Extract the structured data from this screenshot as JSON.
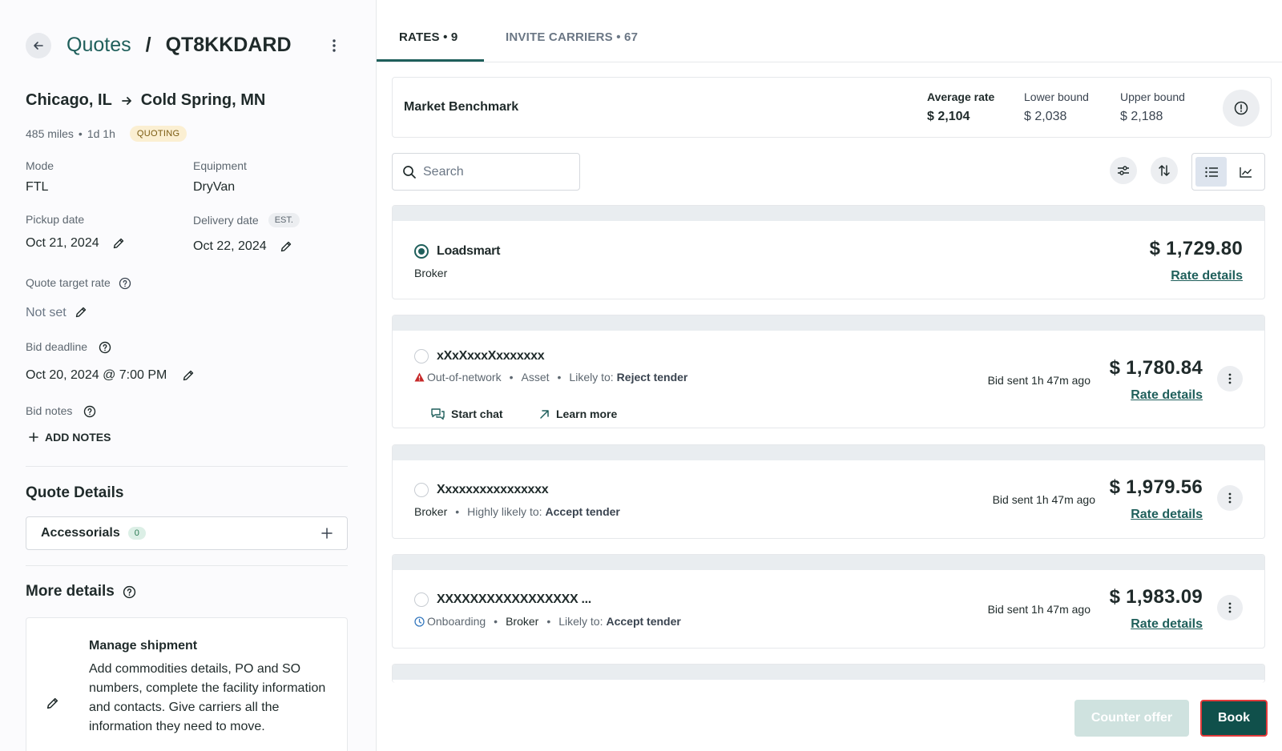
{
  "header": {
    "breadcrumb_parent": "Quotes",
    "breadcrumb_separator": "/",
    "quote_id": "QT8KKDARD"
  },
  "shipment": {
    "origin": "Chicago, IL",
    "destination": "Cold Spring, MN",
    "distance": "485 miles",
    "duration": "1d 1h",
    "status_badge": "QUOTING",
    "mode_label": "Mode",
    "mode_value": "FTL",
    "equipment_label": "Equipment",
    "equipment_value": "DryVan",
    "pickup_label": "Pickup date",
    "pickup_value": "Oct 21, 2024",
    "delivery_label": "Delivery date",
    "delivery_badge": "EST.",
    "delivery_value": "Oct 22, 2024",
    "target_rate_label": "Quote target rate",
    "target_rate_value": "Not set",
    "bid_deadline_label": "Bid deadline",
    "bid_deadline_value": "Oct 20, 2024 @ 7:00 PM",
    "bid_notes_label": "Bid notes",
    "add_notes_label": "ADD NOTES"
  },
  "quote_details": {
    "title": "Quote Details",
    "accessorials_label": "Accessorials",
    "accessorials_count": "0"
  },
  "more_details": {
    "title": "More details",
    "manage_title": "Manage shipment",
    "manage_text": "Add commodities details, PO and SO numbers, complete the facility information and contacts. Give carriers all the information they need to move."
  },
  "tabs": [
    {
      "label": "RATES • 9",
      "active": true
    },
    {
      "label": "INVITE CARRIERS • 67",
      "active": false
    }
  ],
  "benchmark": {
    "title": "Market Benchmark",
    "average_label": "Average rate",
    "average_value": "$ 2,104",
    "lower_label": "Lower bound",
    "lower_value": "$ 2,038",
    "upper_label": "Upper bound",
    "upper_value": "$ 2,188"
  },
  "search": {
    "placeholder": "Search"
  },
  "rates": [
    {
      "name": "Loadsmart",
      "type": "Broker",
      "price": "$ 1,729.80",
      "link": "Rate details",
      "selected": true
    },
    {
      "name": "xXxXxxxXxxxxxxx",
      "network": "Out-of-network",
      "type": "Asset",
      "likely_label": "Likely to:",
      "likely_value": "Reject tender",
      "bid_sent": "Bid sent 1h 47m ago",
      "price": "$ 1,780.84",
      "link": "Rate details",
      "start_chat": "Start chat",
      "learn_more": "Learn more"
    },
    {
      "name": "Xxxxxxxxxxxxxxxx",
      "type": "Broker",
      "likely_label": "Highly likely to:",
      "likely_value": "Accept tender",
      "bid_sent": "Bid sent 1h 47m ago",
      "price": "$ 1,979.56",
      "link": "Rate details"
    },
    {
      "name": "XXXXXXXXXXXXXXXXX ...",
      "onboarding": "Onboarding",
      "type": "Broker",
      "likely_label": "Likely to:",
      "likely_value": "Accept tender",
      "bid_sent": "Bid sent 1h 47m ago",
      "price": "$ 1,983.09",
      "link": "Rate details"
    }
  ],
  "footer": {
    "counter_offer": "Counter offer",
    "book": "Book"
  },
  "colors": {
    "brand": "#1f5f5b",
    "book_button": "#10504b",
    "warning": "#c62828",
    "onboarding": "#3a7bbf"
  }
}
